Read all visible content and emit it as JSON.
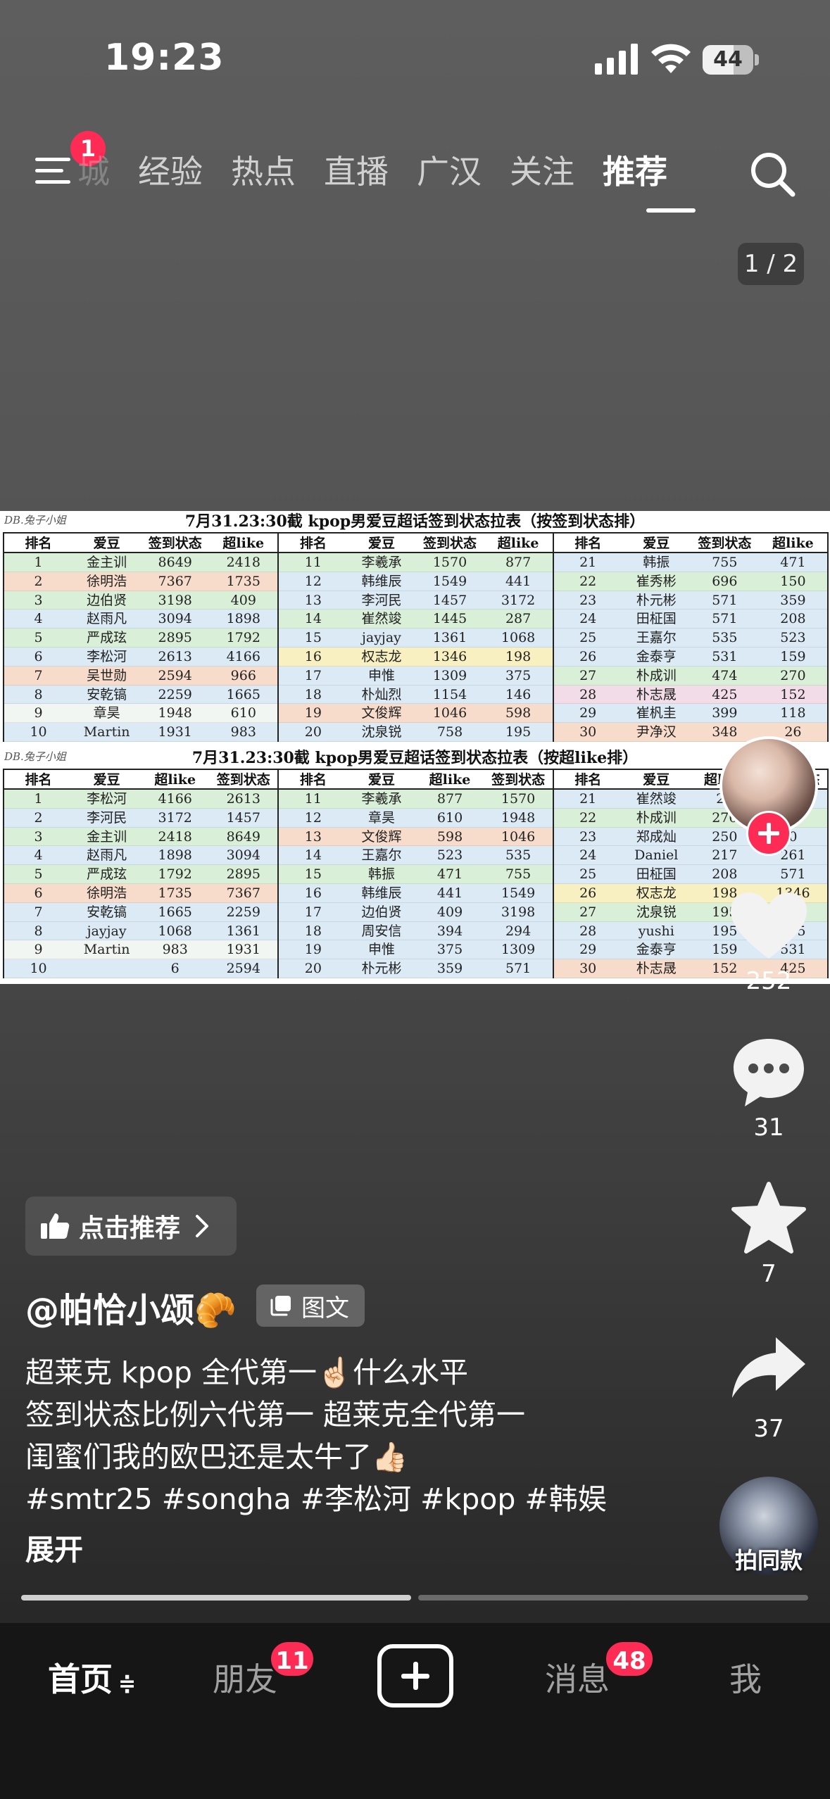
{
  "status_bar": {
    "time": "19:23",
    "battery": "44"
  },
  "top_nav": {
    "menu_badge": "1",
    "tabs": [
      {
        "label": "城",
        "partial": true
      },
      {
        "label": "经验"
      },
      {
        "label": "热点"
      },
      {
        "label": "直播"
      },
      {
        "label": "广汉"
      },
      {
        "label": "关注"
      },
      {
        "label": "推荐",
        "active": true
      }
    ]
  },
  "page_indicator": "1 / 2",
  "post_image": {
    "watermark": "DB.兔子小姐",
    "table1": {
      "title": "7月31.23:30截 kpop男爱豆超话签到状态拉表（按签到状态排）",
      "headers": [
        "排名",
        "爱豆",
        "签到状态",
        "超like"
      ],
      "rows": [
        [
          "1",
          "金主训",
          "8649",
          "2418"
        ],
        [
          "2",
          "徐明浩",
          "7367",
          "1735"
        ],
        [
          "3",
          "边伯贤",
          "3198",
          "409"
        ],
        [
          "4",
          "赵雨凡",
          "3094",
          "1898"
        ],
        [
          "5",
          "严成玹",
          "2895",
          "1792"
        ],
        [
          "6",
          "李松河",
          "2613",
          "4166"
        ],
        [
          "7",
          "吴世勋",
          "2594",
          "966"
        ],
        [
          "8",
          "安乾镐",
          "2259",
          "1665"
        ],
        [
          "9",
          "章昊",
          "1948",
          "610"
        ],
        [
          "10",
          "Martin",
          "1931",
          "983"
        ],
        [
          "11",
          "李羲承",
          "1570",
          "877"
        ],
        [
          "12",
          "韩维辰",
          "1549",
          "441"
        ],
        [
          "13",
          "李河民",
          "1457",
          "3172"
        ],
        [
          "14",
          "崔然竣",
          "1445",
          "287"
        ],
        [
          "15",
          "jayjay",
          "1361",
          "1068"
        ],
        [
          "16",
          "权志龙",
          "1346",
          "198"
        ],
        [
          "17",
          "申惟",
          "1309",
          "375"
        ],
        [
          "18",
          "朴灿烈",
          "1154",
          "146"
        ],
        [
          "19",
          "文俊辉",
          "1046",
          "598"
        ],
        [
          "20",
          "沈泉锐",
          "758",
          "195"
        ],
        [
          "21",
          "韩振",
          "755",
          "471"
        ],
        [
          "22",
          "崔秀彬",
          "696",
          "150"
        ],
        [
          "23",
          "朴元彬",
          "571",
          "359"
        ],
        [
          "24",
          "田柾国",
          "571",
          "208"
        ],
        [
          "25",
          "王嘉尔",
          "535",
          "523"
        ],
        [
          "26",
          "金泰亨",
          "531",
          "159"
        ],
        [
          "27",
          "朴成训",
          "474",
          "270"
        ],
        [
          "28",
          "朴志晟",
          "425",
          "152"
        ],
        [
          "29",
          "崔杋圭",
          "399",
          "118"
        ],
        [
          "30",
          "尹净汉",
          "348",
          "26"
        ]
      ]
    },
    "table2": {
      "title": "7月31.23:30截 kpop男爱豆超话签到状态拉表（按超like排）",
      "headers": [
        "排名",
        "爱豆",
        "超like",
        "签到状态"
      ],
      "rows": [
        [
          "1",
          "李松河",
          "4166",
          "2613"
        ],
        [
          "2",
          "李河民",
          "3172",
          "1457"
        ],
        [
          "3",
          "金主训",
          "2418",
          "8649"
        ],
        [
          "4",
          "赵雨凡",
          "1898",
          "3094"
        ],
        [
          "5",
          "严成玹",
          "1792",
          "2895"
        ],
        [
          "6",
          "徐明浩",
          "1735",
          "7367"
        ],
        [
          "7",
          "安乾镐",
          "1665",
          "2259"
        ],
        [
          "8",
          "jayjay",
          "1068",
          "1361"
        ],
        [
          "9",
          "Martin",
          "983",
          "1931"
        ],
        [
          "10",
          "",
          "6",
          "2594"
        ],
        [
          "11",
          "李羲承",
          "877",
          "1570"
        ],
        [
          "12",
          "章昊",
          "610",
          "1948"
        ],
        [
          "13",
          "文俊辉",
          "598",
          "1046"
        ],
        [
          "14",
          "王嘉尔",
          "523",
          "535"
        ],
        [
          "15",
          "韩振",
          "471",
          "755"
        ],
        [
          "16",
          "韩维辰",
          "441",
          "1549"
        ],
        [
          "17",
          "边伯贤",
          "409",
          "3198"
        ],
        [
          "18",
          "周安信",
          "394",
          "294"
        ],
        [
          "19",
          "申惟",
          "375",
          "1309"
        ],
        [
          "20",
          "朴元彬",
          "359",
          "571"
        ],
        [
          "21",
          "崔然竣",
          "28",
          "0"
        ],
        [
          "22",
          "朴成训",
          "270",
          ""
        ],
        [
          "23",
          "郑成灿",
          "250",
          "0"
        ],
        [
          "24",
          "Daniel",
          "217",
          "261"
        ],
        [
          "25",
          "田柾国",
          "208",
          "571"
        ],
        [
          "26",
          "权志龙",
          "198",
          "1346"
        ],
        [
          "27",
          "沈泉锐",
          "195",
          "758"
        ],
        [
          "28",
          "yushi",
          "195",
          "295"
        ],
        [
          "29",
          "金泰亨",
          "159",
          "531"
        ],
        [
          "30",
          "朴志晟",
          "152",
          "425"
        ]
      ]
    }
  },
  "right_rail": {
    "like_count": "252",
    "comment_count": "31",
    "favorite_count": "7",
    "share_count": "37",
    "same_style_label": "拍同款"
  },
  "post": {
    "recommend_label": "点击推荐",
    "author": "@帕恰小颂🥐",
    "type_tag": "图文",
    "desc_lines": [
      "超莱克 kpop 全代第一☝🏻什么水平",
      "签到状态比例六代第一 超莱克全代第一",
      "闺蜜们我的欧巴还是太牛了👍🏻",
      "#smtr25 #songha #李松河 #kpop #韩娱"
    ],
    "expand_label": "展开"
  },
  "bottom_nav": {
    "home": "首页",
    "home_suffix": "≑",
    "friends": "朋友",
    "friends_badge": "11",
    "messages": "消息",
    "messages_badge": "48",
    "me": "我"
  },
  "colors": {
    "accent": "#fe2c55",
    "bg_dark": "#161616"
  }
}
